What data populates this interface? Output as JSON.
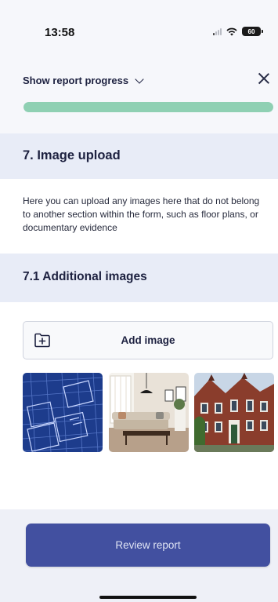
{
  "status_bar": {
    "time": "13:58",
    "battery": "60",
    "icons": [
      "cellular-signal-icon",
      "wifi-icon",
      "battery-icon"
    ]
  },
  "progress": {
    "toggle_label": "Show report progress",
    "fraction": 1.0,
    "fill_color": "#8fd0b3",
    "track_color": "#dfe4ee"
  },
  "section": {
    "title": "7. Image upload",
    "description": "Here you can upload any images here that do not belong to another section within the form, such as floor plans, or documentary evidence"
  },
  "subsection": {
    "title": "7.1 Additional images",
    "add_button_label": "Add image",
    "images": [
      {
        "name": "floor-plan-blueprint"
      },
      {
        "name": "living-room-interior"
      },
      {
        "name": "brick-house-exterior"
      }
    ]
  },
  "footer": {
    "review_label": "Review report",
    "accent": "#4250a0"
  }
}
